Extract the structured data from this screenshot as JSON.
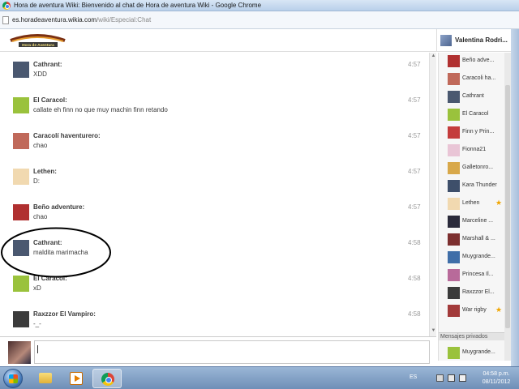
{
  "window": {
    "title": "Hora de aventura Wiki: Bienvenido al chat de Hora de aventura Wiki - Google Chrome"
  },
  "address": {
    "domain": "es.horadeaventura.wikia.com",
    "path": "/wiki/Especial:Chat"
  },
  "header": {
    "logo_text": "Hora de Aventura",
    "user_name": "Valentina Rodri..."
  },
  "messages": [
    {
      "name": "Cathrant:",
      "text": "XDD",
      "time": "4:57",
      "avatar": "dark-silhouette-avatar",
      "color": "#4a5870"
    },
    {
      "name": "El Caracol:",
      "text": "callate eh finn no que muy machin finn retando",
      "time": "4:57",
      "avatar": "snail-avatar",
      "color": "#9ac23c"
    },
    {
      "name": "Caracolí haventurero:",
      "text": "chao",
      "time": "4:57",
      "avatar": "sphere-avatar",
      "color": "#c0695a"
    },
    {
      "name": "Lethen:",
      "text": "D:",
      "time": "4:57",
      "avatar": "blonde-avatar",
      "color": "#f1d9b0"
    },
    {
      "name": "Beño adventure:",
      "text": "chao",
      "time": "4:57",
      "avatar": "red-character-avatar",
      "color": "#b03030"
    },
    {
      "name": "Cathrant:",
      "text": "maldita marimacha",
      "time": "4:58",
      "avatar": "dark-silhouette-avatar",
      "color": "#4a5870"
    },
    {
      "name": "El Caracol:",
      "text": "xD",
      "time": "4:58",
      "avatar": "snail-avatar",
      "color": "#9ac23c"
    },
    {
      "name": "Raxzzor El Vampiro:",
      "text": "-_-",
      "time": "4:58",
      "avatar": "vampire-avatar",
      "color": "#3b3b3b"
    }
  ],
  "users": [
    {
      "name": "Beño adve...",
      "color": "#b03030",
      "star": ""
    },
    {
      "name": "Caracoli ha...",
      "color": "#c0695a",
      "star": ""
    },
    {
      "name": "Cathrant",
      "color": "#4a5870",
      "star": ""
    },
    {
      "name": "El Caracol",
      "color": "#9ac23c",
      "star": ""
    },
    {
      "name": "Finn y Prin...",
      "color": "#c43c3c",
      "star": ""
    },
    {
      "name": "Fionna21",
      "color": "#e9c5d6",
      "star": ""
    },
    {
      "name": "Galletonro...",
      "color": "#d8a84a",
      "star": ""
    },
    {
      "name": "Kara Thunder",
      "color": "#3e4f6a",
      "star": ""
    },
    {
      "name": "Lethen",
      "color": "#f1d9b0",
      "star": "★"
    },
    {
      "name": "Marceline ...",
      "color": "#2a2a3a",
      "star": ""
    },
    {
      "name": "Marshall & ...",
      "color": "#7c2f2f",
      "star": ""
    },
    {
      "name": "Muygrande...",
      "color": "#3f6ea8",
      "star": ""
    },
    {
      "name": "Princesa Il...",
      "color": "#b86a9a",
      "star": ""
    },
    {
      "name": "Raxzzor El...",
      "color": "#3b3b3b",
      "star": ""
    },
    {
      "name": "War rigby",
      "color": "#a23a3a",
      "star": "★"
    }
  ],
  "private": {
    "header": "Mensajes privados",
    "users": [
      {
        "name": "Muygrande...",
        "color": "#9ac23c"
      }
    ]
  },
  "taskbar": {
    "language": "ES",
    "time": "04:58 p.m.",
    "date": "08/11/2012"
  }
}
